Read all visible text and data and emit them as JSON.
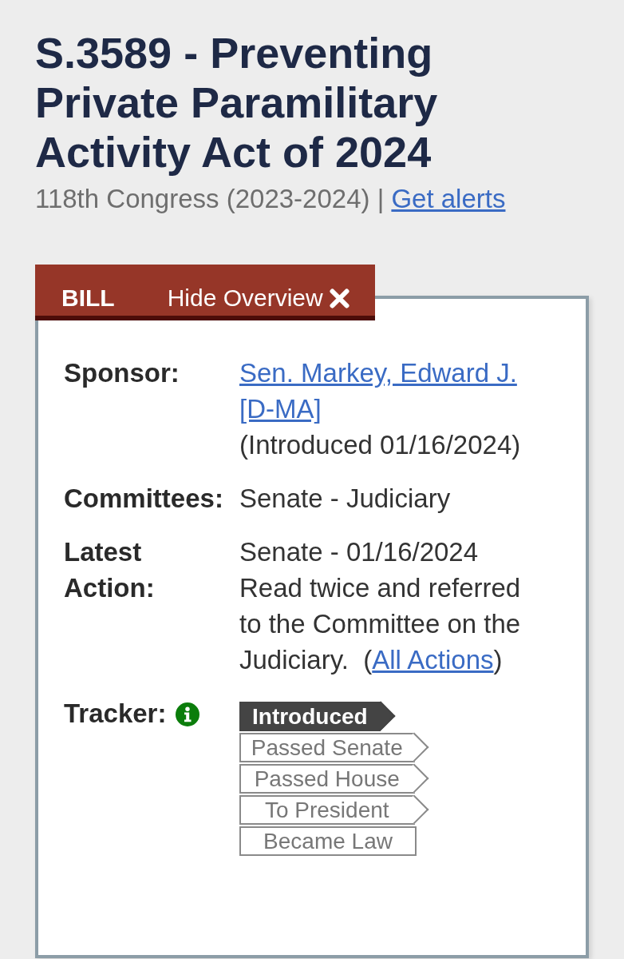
{
  "bill": {
    "title": "S.3589 - Preventing Private Paramilitary Activity Act of 2024",
    "congress": "118th Congress (2023-2024) |",
    "alerts_link": "Get alerts"
  },
  "overview": {
    "tab_label": "BILL",
    "hide_button": "Hide Overview",
    "fields": [
      {
        "kind": "sponsor",
        "label": "Sponsor:",
        "link": "Sen. Markey, Edward J. [D-MA]",
        "note": "(Introduced 01/16/2024)"
      },
      {
        "kind": "text",
        "label": "Committees:",
        "value": "Senate - Judiciary"
      },
      {
        "kind": "action",
        "label": "Latest Action:",
        "date": "Senate - 01/16/2024",
        "text": "Read twice and referred to the Committee on the Judiciary.  (",
        "link": "All Actions",
        "text_after": ")"
      },
      {
        "kind": "tracker",
        "label": "Tracker:",
        "steps": [
          {
            "label": "Introduced",
            "current": true
          },
          {
            "label": "Passed Senate",
            "current": false
          },
          {
            "label": "Passed House",
            "current": false
          },
          {
            "label": "To President",
            "current": false
          },
          {
            "label": "Became Law",
            "current": false
          }
        ]
      }
    ]
  }
}
